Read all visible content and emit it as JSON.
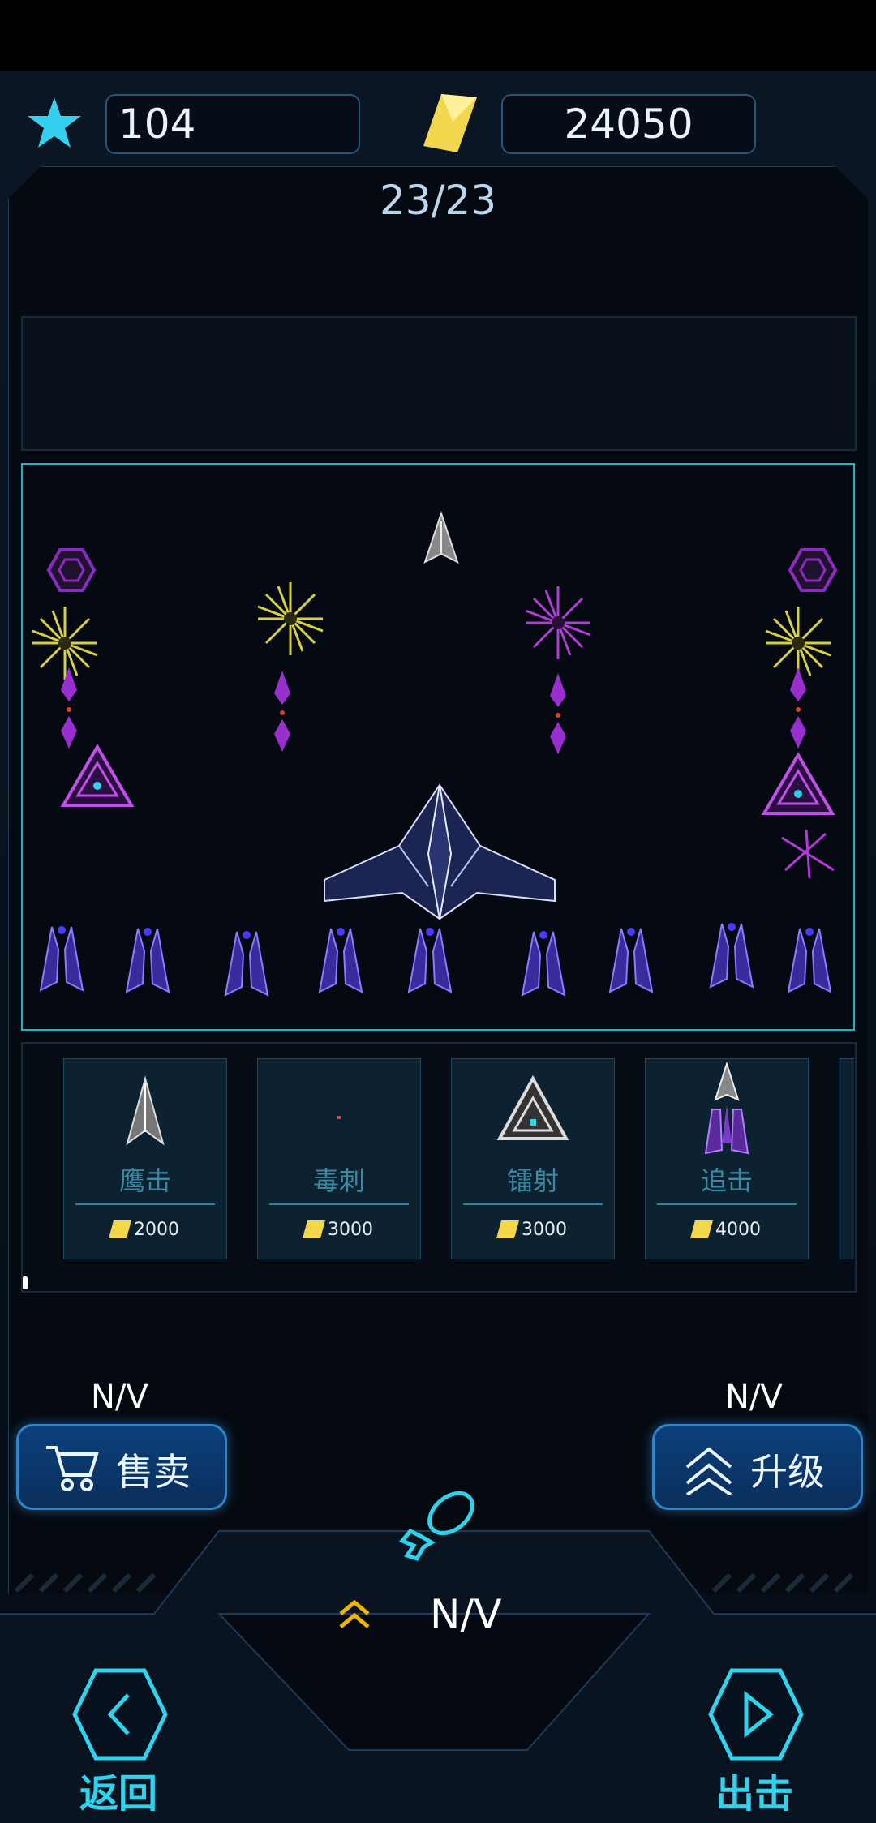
{
  "hud": {
    "stars": "104",
    "crystals": "24050",
    "wave": "23/23"
  },
  "shop": {
    "items": [
      {
        "name": "鹰击",
        "price": "2000"
      },
      {
        "name": "毒刺",
        "price": "3000"
      },
      {
        "name": "镭射",
        "price": "3000"
      },
      {
        "name": "追击",
        "price": "4000"
      }
    ]
  },
  "actions": {
    "sell_label": "售卖",
    "sell_value": "N/V",
    "upgrade_label": "升级",
    "upgrade_value": "N/V",
    "bomb_value": "N/V"
  },
  "nav": {
    "back_label": "返回",
    "go_label": "出击"
  },
  "colors": {
    "accent": "#2ed3ee",
    "gold": "#f2d64b",
    "purple": "#8a2be2"
  }
}
